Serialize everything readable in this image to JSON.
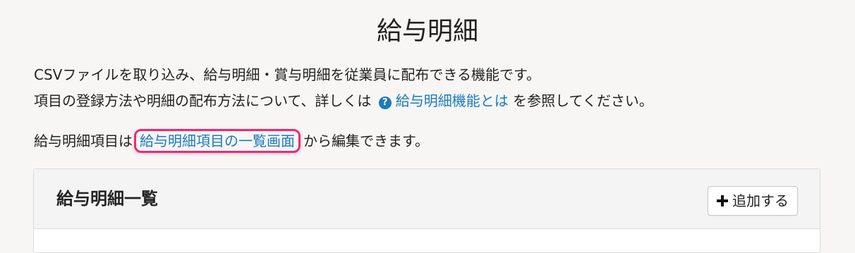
{
  "page": {
    "title": "給与明細"
  },
  "description": {
    "line1": "CSVファイルを取り込み、給与明細・賞与明細を従業員に配布できる機能です。",
    "line2_before": "項目の登録方法や明細の配布方法について、詳しくは",
    "help_icon": "question-circle-icon",
    "help_icon_glyph": "?",
    "help_link": "給与明細機能とは",
    "line2_after": "を参照してください。"
  },
  "items_note": {
    "before": "給与明細項目は",
    "link": "給与明細項目の一覧画面",
    "after": "から編集できます。"
  },
  "panel": {
    "title": "給与明細一覧",
    "add_button_icon": "plus-icon",
    "add_button_label": "追加する"
  },
  "colors": {
    "link": "#1a7abf",
    "highlight_border": "#ec2a74",
    "background": "#f7f6f5"
  }
}
